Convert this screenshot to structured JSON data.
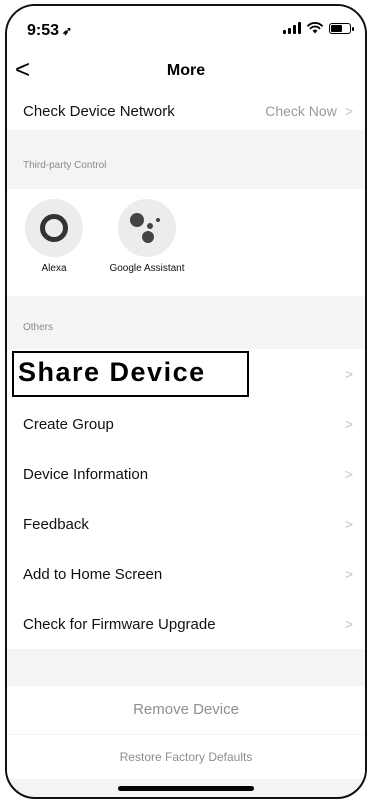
{
  "status_bar": {
    "time": "9:53",
    "location_glyph": "➶"
  },
  "nav": {
    "back_glyph": "<",
    "title": "More"
  },
  "network_row": {
    "label": "Check Device Network",
    "value": "Check Now",
    "chevron": ">"
  },
  "third_party": {
    "section_label": "Third-party Control",
    "items": [
      {
        "label": "Alexa",
        "icon": "alexa-icon"
      },
      {
        "label": "Google Assistant",
        "icon": "google-assistant-icon"
      }
    ]
  },
  "others": {
    "section_label": "Others",
    "share_label": "Share Device",
    "items": [
      {
        "label": "Share Device"
      },
      {
        "label": "Create Group"
      },
      {
        "label": "Device Information"
      },
      {
        "label": "Feedback"
      },
      {
        "label": "Add to Home Screen"
      },
      {
        "label": "Check for Firmware Upgrade"
      }
    ],
    "chevron": ">"
  },
  "actions": {
    "remove": "Remove Device",
    "restore": "Restore Factory Defaults"
  }
}
